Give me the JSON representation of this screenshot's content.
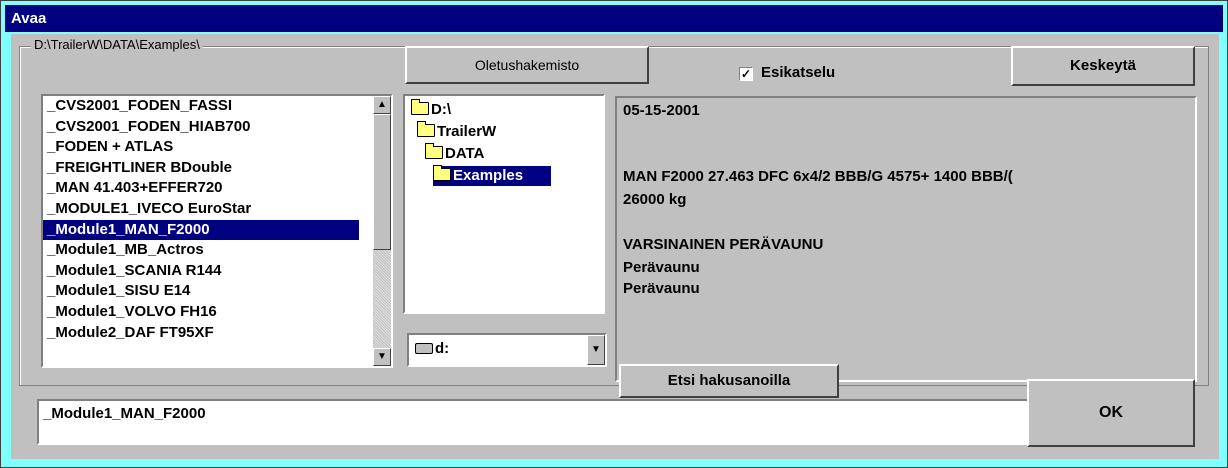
{
  "window": {
    "title": "Avaa"
  },
  "group": {
    "label": "D:\\TrailerW\\DATA\\Examples\\"
  },
  "buttons": {
    "default_dir": "Oletushakemisto",
    "cancel": "Keskeytä",
    "search": "Etsi hakusanoilla",
    "ok": "OK"
  },
  "preview_toggle": {
    "label": "Esikatselu",
    "checked": true
  },
  "file_list": [
    "_CVS2001_FODEN_FASSI",
    "_CVS2001_FODEN_HIAB700",
    "_FODEN + ATLAS",
    "_FREIGHTLINER BDouble",
    "_MAN 41.403+EFFER720",
    "_MODULE1_IVECO EuroStar",
    "_Module1_MAN_F2000",
    "_Module1_MB_Actros",
    "_Module1_SCANIA R144",
    "_Module1_SISU E14",
    "_Module1_VOLVO FH16",
    "_Module2_DAF FT95XF"
  ],
  "selected_file_index": 6,
  "directories": [
    "D:\\",
    "TrailerW",
    "DATA",
    "Examples"
  ],
  "selected_directory_index": 3,
  "drive": {
    "value": "d:"
  },
  "preview": {
    "date": "05-15-2001",
    "model": "MAN F2000 27.463 DFC 6x4/2 BBB/G  4575+ 1400 BBB/(",
    "weight": " 26000  kg",
    "trailer_title": "VARSINAINEN PERÄVAUNU",
    "line1": "Perävaunu",
    "line2": "Perävaunu"
  },
  "filename_field": {
    "value": "_Module1_MAN_F2000"
  }
}
